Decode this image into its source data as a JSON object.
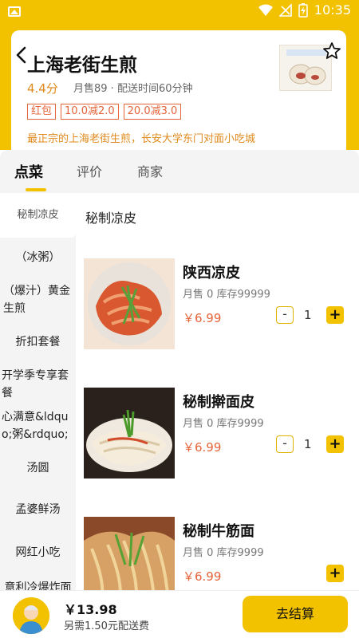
{
  "status_bar": {
    "time": "10:35"
  },
  "shop": {
    "name": "上海老街生煎",
    "rating": "4.4分",
    "meta": "月售89 · 配送时间60分钟",
    "tags": [
      "红包",
      "10.0减2.0",
      "20.0减3.0"
    ],
    "notice": "最正宗的上海老街生煎，长安大学东门对面小吃城"
  },
  "tabs": [
    "点菜",
    "评价",
    "商家"
  ],
  "sidebar": {
    "active": "秘制凉皮",
    "items": [
      "（冰粥）",
      "（爆汁）黄金生煎",
      "折扣套餐",
      "开学季专享套餐",
      "心满意&ldquo;粥&rdquo;",
      "汤圆",
      "孟婆鲜汤",
      "网红小吃",
      "意利冷爆炸面"
    ]
  },
  "category_title": "秘制凉皮",
  "dishes": [
    {
      "name": "陕西凉皮",
      "stock": "月售 0 库存99999",
      "price": "￥6.99",
      "minus": "-",
      "qty": "1",
      "plus": "+"
    },
    {
      "name": "秘制擀面皮",
      "stock": "月售 0 库存9999",
      "price": "￥6.99",
      "minus": "-",
      "qty": "1",
      "plus": "+"
    },
    {
      "name": "秘制牛筋面",
      "stock": "月售 0 库存9999",
      "price": "￥6.99",
      "plus": "+"
    }
  ],
  "cart": {
    "total": "￥13.98",
    "delivery_note": "另需1.50元配送费",
    "checkout_label": "去结算"
  },
  "colors": {
    "accent": "#f2c200",
    "price": "#e5643a",
    "notice": "#e08a1e"
  }
}
